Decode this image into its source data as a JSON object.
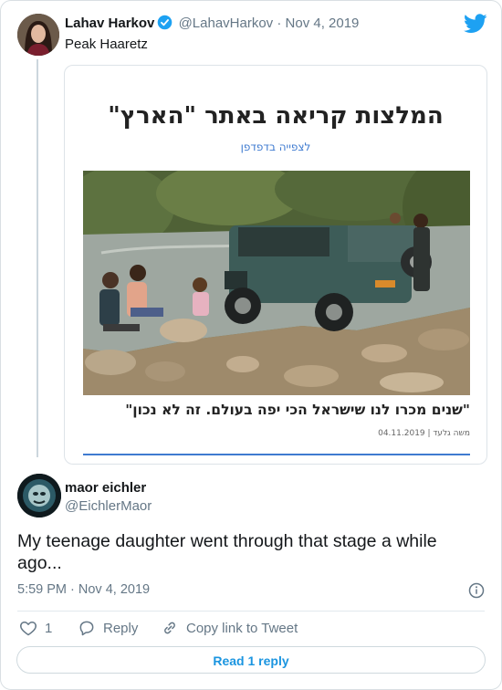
{
  "parent_tweet": {
    "author_name": "Lahav Harkov",
    "handle": "@LahavHarkov",
    "separator": "·",
    "date": "Nov 4, 2019",
    "text": "Peak Haaretz",
    "embed": {
      "headline": "המלצות קריאה באתר \"הארץ\"",
      "subline": "לצפייה בדפדפן",
      "caption": "\"שנים מכרו לנו שישראל הכי יפה בעולם. זה לא נכון\"",
      "byline": "משה גלעד | 04.11.2019"
    }
  },
  "reply_tweet": {
    "author_name": "maor eichler",
    "handle": "@EichlerMaor",
    "text": "My teenage daughter went through that stage a while ago...",
    "timestamp": "5:59 PM · Nov 4, 2019",
    "actions": {
      "like_count": "1",
      "reply_label": "Reply",
      "copy_label": "Copy link to Tweet"
    },
    "read_replies_label": "Read 1 reply"
  },
  "colors": {
    "twitter_blue": "#1da1f2",
    "link_blue": "#1b95e0",
    "muted_text": "#657786"
  }
}
